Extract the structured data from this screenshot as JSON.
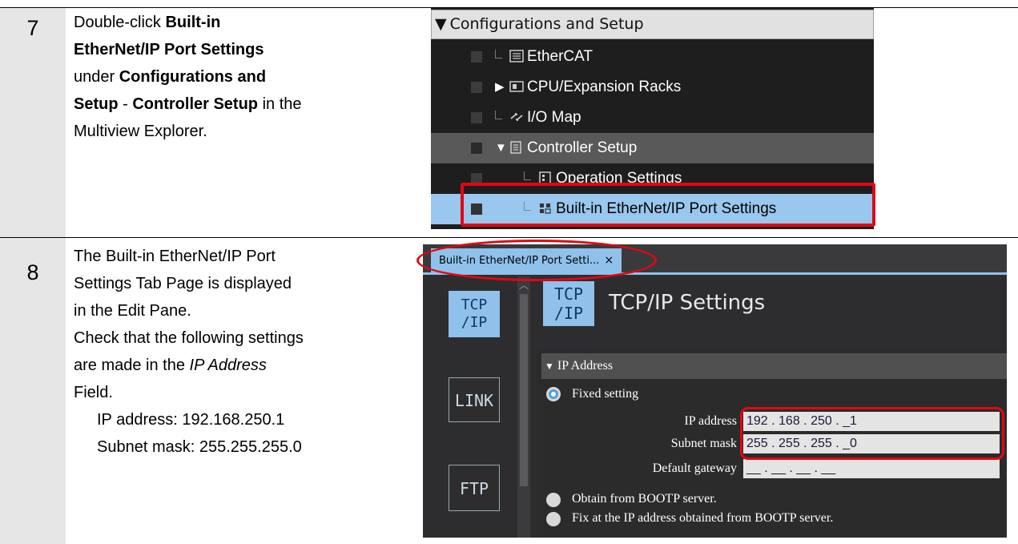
{
  "steps": [
    {
      "number": "7",
      "text": {
        "l1a": "Double-click ",
        "l1b": "Built-in",
        "l2": "EtherNet/IP Port Settings",
        "l3a": "under ",
        "l3b": "Configurations and",
        "l4a": "Setup",
        "l4b": " - ",
        "l4c": "Controller Setup",
        "l4d": " in the",
        "l5": "Multiview Explorer."
      },
      "tree": {
        "header": "Configurations and Setup",
        "items": [
          {
            "label": "EtherCAT",
            "icon": "ethercat-icon"
          },
          {
            "label": "CPU/Expansion Racks",
            "icon": "cpu-rack-icon"
          },
          {
            "label": "I/O Map",
            "icon": "io-map-icon"
          },
          {
            "label": "Controller Setup",
            "icon": "controller-setup-icon"
          },
          {
            "label": "Operation Settings",
            "icon": "operation-settings-icon"
          },
          {
            "label": "Built-in EtherNet/IP Port Settings",
            "icon": "eip-port-icon"
          }
        ]
      }
    },
    {
      "number": "8",
      "text": {
        "l1": "The Built-in EtherNet/IP Port",
        "l2": "Settings Tab Page is displayed",
        "l3": "in the Edit Pane.",
        "l4": "Check that the following settings",
        "l5a": "are made in the ",
        "l5b": "IP Address",
        "l6": "Field.",
        "l7": "IP address: 192.168.250.1",
        "l8": "Subnet mask: 255.255.255.0"
      },
      "editor": {
        "tab_label": "Built-in EtherNet/IP Port Setti...",
        "tab_close": "×",
        "side_tcp": "TCP\n/IP",
        "side_link": "LINK",
        "side_ftp": "FTP",
        "title": "TCP/IP Settings",
        "section": "IP Address",
        "fixed_setting": "Fixed setting",
        "ip_label": "IP address",
        "ip_value": "192 . 168 . 250 . _1",
        "subnet_label": "Subnet mask",
        "subnet_value": "255 . 255 . 255 . _0",
        "gateway_label": "Default gateway",
        "gateway_value": "__ . __ . __ . __",
        "opt_bootp": "Obtain from BOOTP server.",
        "opt_fix_bootp": "Fix at the IP address obtained from BOOTP server."
      }
    }
  ]
}
